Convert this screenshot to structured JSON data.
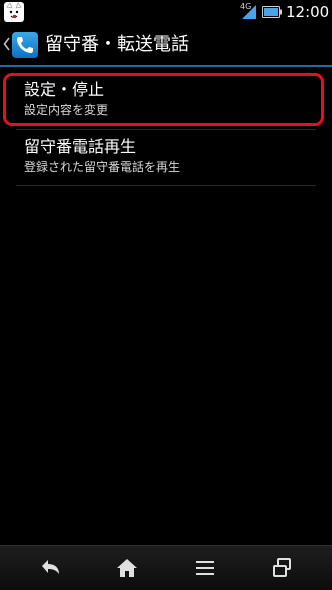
{
  "status_bar": {
    "network_type": "4G",
    "time": "12:00"
  },
  "action_bar": {
    "title": "留守番・転送電話"
  },
  "list": {
    "items": [
      {
        "title": "設定・停止",
        "subtitle": "設定内容を変更",
        "highlighted": true
      },
      {
        "title": "留守番電話再生",
        "subtitle": "登録された留守番電話を再生",
        "highlighted": false
      }
    ]
  },
  "nav_bar": {
    "buttons": [
      "back-icon",
      "home-icon",
      "menu-icon",
      "recent-apps-icon"
    ]
  },
  "colors": {
    "highlight": "#e4101e",
    "accent": "#1a6fa8",
    "app_icon": "#0a72c2"
  }
}
